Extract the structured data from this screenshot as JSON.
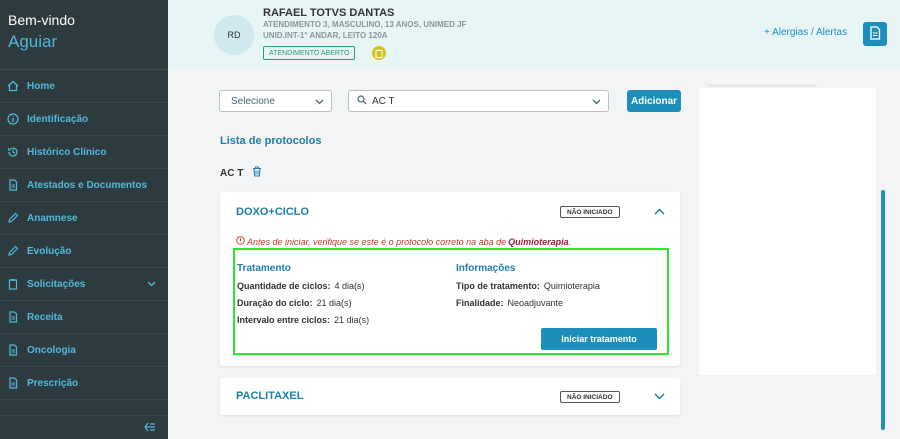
{
  "sidebar": {
    "welcome": "Bem-vindo",
    "user": "Aguiar",
    "items": [
      {
        "label": "Home",
        "icon": "home-icon"
      },
      {
        "label": "Identificação",
        "icon": "info-icon"
      },
      {
        "label": "Histórico Clínico",
        "icon": "history-icon"
      },
      {
        "label": "Atestados e Documentos",
        "icon": "document-icon"
      },
      {
        "label": "Anamnese",
        "icon": "pencil-icon"
      },
      {
        "label": "Evolução",
        "icon": "pencil-icon"
      },
      {
        "label": "Solicitações",
        "icon": "clipboard-icon"
      },
      {
        "label": "Receita",
        "icon": "document-icon"
      },
      {
        "label": "Oncologia",
        "icon": "document-icon"
      },
      {
        "label": "Prescrição",
        "icon": "document-icon"
      }
    ]
  },
  "header": {
    "avatar_initials": "RD",
    "patient_name": "RAFAEL TOTVS DANTAS",
    "patient_info": "ATENDIMENTO 3, MASCULINO, 13 ANOS, UNIMED JF",
    "patient_location": "UNID.INT-1° ANDAR, LEITO 120A",
    "status_badge": "ATENDIMENTO ABERTO",
    "alerts_link": "+ Alergias / Alertas"
  },
  "filters": {
    "select_value": "Selecione",
    "search_value": "AC T",
    "add_button": "Adicionar"
  },
  "protocols": {
    "list_title": "Lista de protocolos",
    "group_label": "AC T",
    "cards": [
      {
        "title": "DOXO+CICLO",
        "status": "NÃO INICIADO",
        "warning_text": "Antes de iniciar, verifique se este é o protocolo correto na aba de",
        "warning_link": "Quimioterapia",
        "treatment_header": "Tratamento",
        "info_header": "Informações",
        "treatment_rows": [
          {
            "label": "Quantidade de ciclos:",
            "value": "4 dia(s)"
          },
          {
            "label": "Duração do ciclo:",
            "value": "21 dia(s)"
          },
          {
            "label": "Intervalo entre ciclos:",
            "value": "21 dia(s)"
          }
        ],
        "info_rows": [
          {
            "label": "Tipo de tratamento:",
            "value": "Quimioterapia"
          },
          {
            "label": "Finalidade:",
            "value": "Neoadjuvante"
          }
        ],
        "start_button": "Iniciar tratamento"
      },
      {
        "title": "PACLITAXEL",
        "status": "NÃO INICIADO"
      }
    ]
  },
  "colors": {
    "accent": "#1e8fba",
    "sidebar_bg": "#2d3b3f",
    "highlight": "#2ee62e"
  }
}
